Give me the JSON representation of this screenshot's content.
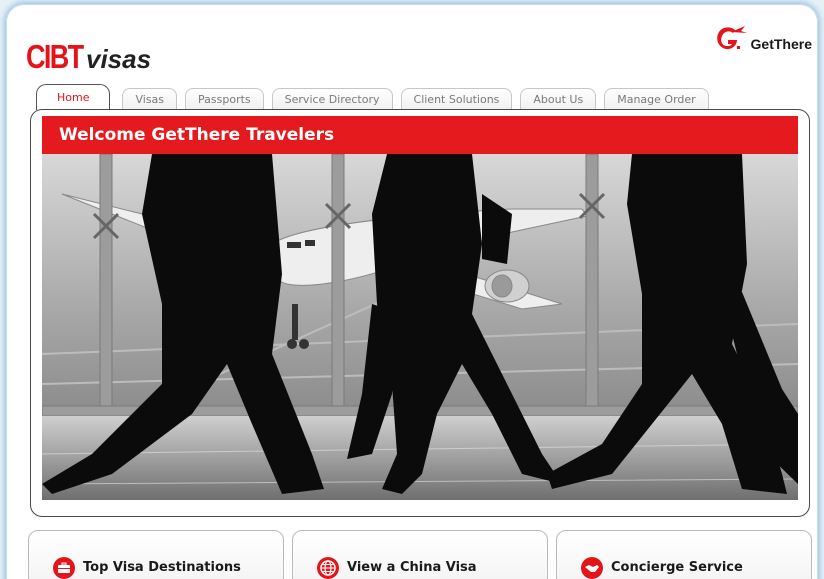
{
  "header": {
    "logo_main": "CIBT",
    "logo_sub": "visas",
    "partner_logo_text": "GetThere",
    "partner_logo_icon": "getthere-g-arrow-icon"
  },
  "tabs": [
    {
      "label": "Home",
      "active": true
    },
    {
      "label": "Visas",
      "active": false
    },
    {
      "label": "Passports",
      "active": false
    },
    {
      "label": "Service Directory",
      "active": false
    },
    {
      "label": "Client Solutions",
      "active": false
    },
    {
      "label": "About Us",
      "active": false
    },
    {
      "label": "Manage Order",
      "active": false
    }
  ],
  "banner": {
    "title": "Welcome GetThere Travelers"
  },
  "cards": [
    {
      "label": "Top Visa Destinations",
      "icon": "suitcase-icon"
    },
    {
      "label": "View a China Visa",
      "icon": "globe-icon"
    },
    {
      "label": "Concierge Service",
      "icon": "handshake-icon"
    }
  ],
  "colors": {
    "brand_red": "#e3151a",
    "banner_red": "#e41a1f",
    "glow_blue": "#9fc3e0"
  }
}
